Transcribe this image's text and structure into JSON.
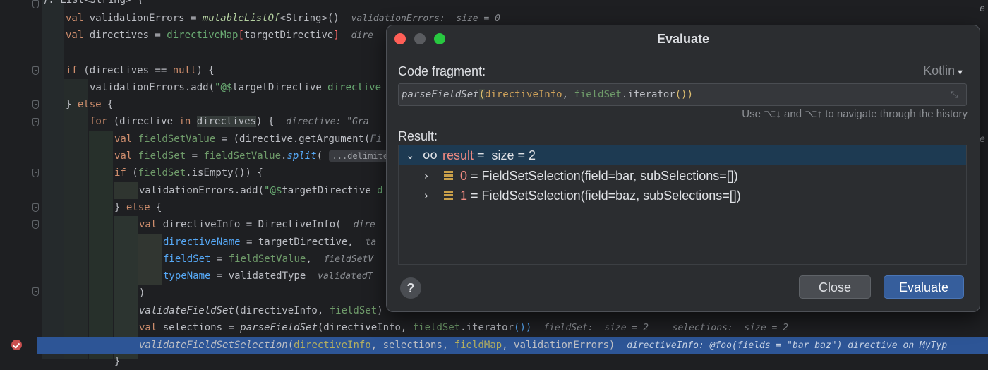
{
  "editor": {
    "lines": {
      "l0": "): List<String> {",
      "l1_a": "val ",
      "l1_b": "validationErrors = ",
      "l1_c": "mutableListOf",
      "l1_d": "<String>()",
      "l1_hint": "validationErrors:  size = 0",
      "l2_a": "val ",
      "l2_b": "directives = ",
      "l2_c": "directiveMap",
      "l2_d": "[",
      "l2_e": "targetDirective",
      "l2_f": "]",
      "l2_hint": "dire",
      "l4_a": "if ",
      "l4_b": "(directives == ",
      "l4_c": "null",
      "l4_d": ") {",
      "l5_a": "validationErrors.add(",
      "l5_b": "\"@$",
      "l5_c": "targetDirective",
      "l5_d": " directive",
      "l6_a": "} ",
      "l6_b": "else",
      "l6_c": " {",
      "l7_a": "for ",
      "l7_b": "(",
      "l7_c": "directive",
      "l7_d": " in ",
      "l7_e": "directives",
      "l7_f": ") {",
      "l7_hint": "directive: \"Gra",
      "l8_a": "val ",
      "l8_b": "fieldSetValue",
      "l8_c": " = (directive.getArgument(",
      "l8_d": "Fi",
      "l9_a": "val ",
      "l9_b": "fieldSet",
      "l9_c": " = ",
      "l9_d": "fieldSetValue",
      "l9_e": ".",
      "l9_f": "split",
      "l9_g": "(",
      "l9_hint": "...delimiters",
      "l10_a": "if ",
      "l10_b": "(",
      "l10_c": "fieldSet",
      "l10_d": ".isEmpty()) {",
      "l11_a": "validationErrors.add(",
      "l11_b": "\"@$",
      "l11_c": "targetDirective",
      "l11_d": " d",
      "l12_a": "} ",
      "l12_b": "else",
      "l12_c": " {",
      "l13_a": "val ",
      "l13_b": "directiveInfo = ",
      "l13_c": "DirectiveInfo(",
      "l13_hint": "dire",
      "l14_a": "directiveName",
      "l14_b": " = targetDirective,",
      "l14_hint": "ta",
      "l15_a": "fieldSet",
      "l15_b": " = ",
      "l15_c": "fieldSetValue",
      "l15_d": ",",
      "l15_hint": "fieldSetV",
      "l16_a": "typeName",
      "l16_b": " = validatedType",
      "l16_hint": "validatedT",
      "l17": ")",
      "l18_a": "validateFieldSet",
      "l18_b": "(directiveInfo, ",
      "l18_c": "fieldSet",
      "l18_d": ")",
      "l19_a": "val ",
      "l19_b": "selections = ",
      "l19_c": "parseFieldSet",
      "l19_d": "(directiveInfo, ",
      "l19_e": "fieldSet",
      "l19_f": ".iterator",
      "l19_g": "())",
      "l19_hint1": "fieldSet:  size = 2",
      "l19_hint2": "selections:  size = 2",
      "l20_a": "validateFieldSetSelection",
      "l20_b": "(",
      "l20_c": "directiveInfo",
      "l20_d": ", selections, ",
      "l20_e": "fieldMap",
      "l20_f": ", validationErrors)",
      "l20_hint": "directiveInfo: @foo(fields = \"bar baz\") directive on MyTyp",
      "l21": "}"
    },
    "right_hint_1": "e",
    "right_hint_2": "e"
  },
  "dialog": {
    "title": "Evaluate",
    "code_fragment_label": "Code fragment:",
    "language": "Kotlin",
    "code": {
      "fn": "parseFieldSet",
      "p1": "(",
      "arg1": "directiveInfo",
      "sep": ", ",
      "arg2": "fieldSet",
      "tail": ".iterator",
      "end": "())"
    },
    "nav_hint": "Use ⌥↓ and ⌥↑ to navigate through the history",
    "result_label": "Result:",
    "result": {
      "root_name": "result",
      "root_value": " =  size = 2",
      "items": [
        {
          "index": "0",
          "value": " = FieldSetSelection(field=bar, subSelections=[])"
        },
        {
          "index": "1",
          "value": " = FieldSetSelection(field=baz, subSelections=[])"
        }
      ]
    },
    "help_label": "?",
    "close_label": "Close",
    "evaluate_label": "Evaluate"
  }
}
